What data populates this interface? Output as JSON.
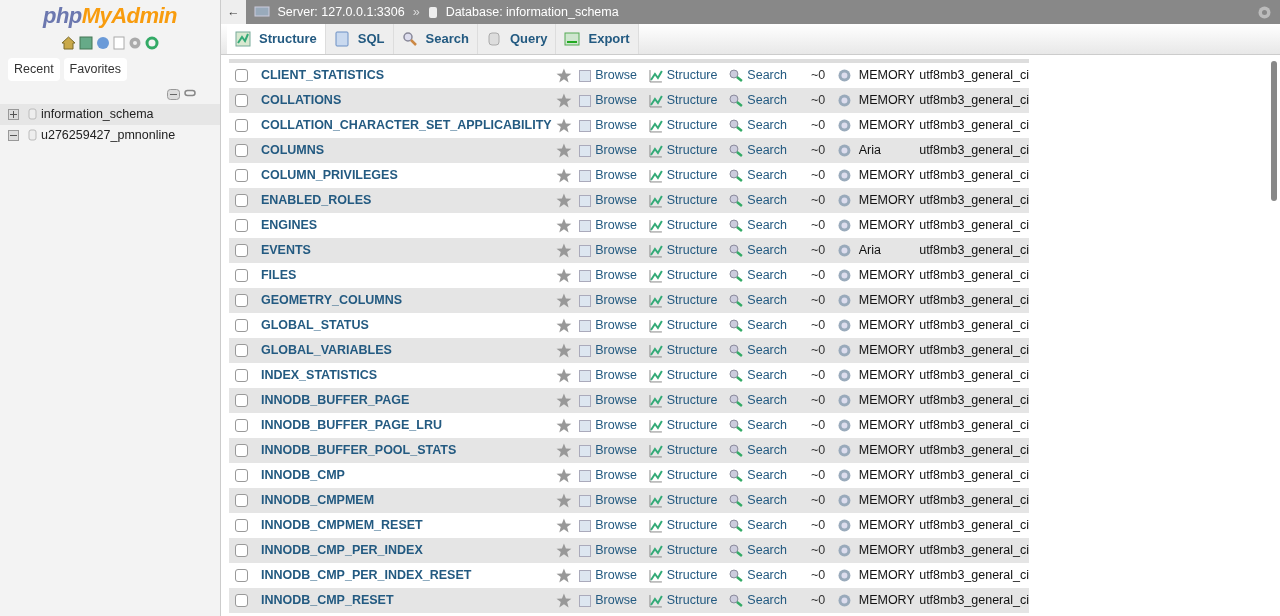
{
  "sidebar": {
    "logo_left": "php",
    "logo_right": "MyAdmin",
    "tabs": [
      {
        "label": "Recent"
      },
      {
        "label": "Favorites"
      }
    ],
    "tree": [
      {
        "label": "information_schema",
        "expanded": false
      },
      {
        "label": "u276259427_pmnonline",
        "expanded": true
      }
    ]
  },
  "breadcrumb": {
    "back": "←",
    "server": "Server: 127.0.0.1:3306",
    "separator": "»",
    "database": "Database: information_schema"
  },
  "tabs": [
    {
      "label": "Structure",
      "selected": true
    },
    {
      "label": "SQL",
      "selected": false
    },
    {
      "label": "Search",
      "selected": false
    },
    {
      "label": "Query",
      "selected": false
    },
    {
      "label": "Export",
      "selected": false
    }
  ],
  "rows": [
    {
      "name": "CLIENT_STATISTICS",
      "checked": false,
      "browse": "Browse",
      "structure": "Structure",
      "search": "Search",
      "rows": "~0",
      "engine": "MEMORY",
      "collation": "utf8mb3_general_ci"
    },
    {
      "name": "COLLATIONS",
      "checked": false,
      "browse": "Browse",
      "structure": "Structure",
      "search": "Search",
      "rows": "~0",
      "engine": "MEMORY",
      "collation": "utf8mb3_general_ci"
    },
    {
      "name": "COLLATION_CHARACTER_SET_APPLICABILITY",
      "checked": false,
      "browse": "Browse",
      "structure": "Structure",
      "search": "Search",
      "rows": "~0",
      "engine": "MEMORY",
      "collation": "utf8mb3_general_ci"
    },
    {
      "name": "COLUMNS",
      "checked": false,
      "browse": "Browse",
      "structure": "Structure",
      "search": "Search",
      "rows": "~0",
      "engine": "Aria",
      "collation": "utf8mb3_general_ci"
    },
    {
      "name": "COLUMN_PRIVILEGES",
      "checked": false,
      "browse": "Browse",
      "structure": "Structure",
      "search": "Search",
      "rows": "~0",
      "engine": "MEMORY",
      "collation": "utf8mb3_general_ci"
    },
    {
      "name": "ENABLED_ROLES",
      "checked": false,
      "browse": "Browse",
      "structure": "Structure",
      "search": "Search",
      "rows": "~0",
      "engine": "MEMORY",
      "collation": "utf8mb3_general_ci"
    },
    {
      "name": "ENGINES",
      "checked": false,
      "browse": "Browse",
      "structure": "Structure",
      "search": "Search",
      "rows": "~0",
      "engine": "MEMORY",
      "collation": "utf8mb3_general_ci"
    },
    {
      "name": "EVENTS",
      "checked": false,
      "browse": "Browse",
      "structure": "Structure",
      "search": "Search",
      "rows": "~0",
      "engine": "Aria",
      "collation": "utf8mb3_general_ci"
    },
    {
      "name": "FILES",
      "checked": false,
      "browse": "Browse",
      "structure": "Structure",
      "search": "Search",
      "rows": "~0",
      "engine": "MEMORY",
      "collation": "utf8mb3_general_ci"
    },
    {
      "name": "GEOMETRY_COLUMNS",
      "checked": false,
      "browse": "Browse",
      "structure": "Structure",
      "search": "Search",
      "rows": "~0",
      "engine": "MEMORY",
      "collation": "utf8mb3_general_ci"
    },
    {
      "name": "GLOBAL_STATUS",
      "checked": false,
      "browse": "Browse",
      "structure": "Structure",
      "search": "Search",
      "rows": "~0",
      "engine": "MEMORY",
      "collation": "utf8mb3_general_ci"
    },
    {
      "name": "GLOBAL_VARIABLES",
      "checked": false,
      "browse": "Browse",
      "structure": "Structure",
      "search": "Search",
      "rows": "~0",
      "engine": "MEMORY",
      "collation": "utf8mb3_general_ci"
    },
    {
      "name": "INDEX_STATISTICS",
      "checked": false,
      "browse": "Browse",
      "structure": "Structure",
      "search": "Search",
      "rows": "~0",
      "engine": "MEMORY",
      "collation": "utf8mb3_general_ci"
    },
    {
      "name": "INNODB_BUFFER_PAGE",
      "checked": false,
      "browse": "Browse",
      "structure": "Structure",
      "search": "Search",
      "rows": "~0",
      "engine": "MEMORY",
      "collation": "utf8mb3_general_ci"
    },
    {
      "name": "INNODB_BUFFER_PAGE_LRU",
      "checked": false,
      "browse": "Browse",
      "structure": "Structure",
      "search": "Search",
      "rows": "~0",
      "engine": "MEMORY",
      "collation": "utf8mb3_general_ci"
    },
    {
      "name": "INNODB_BUFFER_POOL_STATS",
      "checked": false,
      "browse": "Browse",
      "structure": "Structure",
      "search": "Search",
      "rows": "~0",
      "engine": "MEMORY",
      "collation": "utf8mb3_general_ci"
    },
    {
      "name": "INNODB_CMP",
      "checked": false,
      "browse": "Browse",
      "structure": "Structure",
      "search": "Search",
      "rows": "~0",
      "engine": "MEMORY",
      "collation": "utf8mb3_general_ci"
    },
    {
      "name": "INNODB_CMPMEM",
      "checked": false,
      "browse": "Browse",
      "structure": "Structure",
      "search": "Search",
      "rows": "~0",
      "engine": "MEMORY",
      "collation": "utf8mb3_general_ci"
    },
    {
      "name": "INNODB_CMPMEM_RESET",
      "checked": false,
      "browse": "Browse",
      "structure": "Structure",
      "search": "Search",
      "rows": "~0",
      "engine": "MEMORY",
      "collation": "utf8mb3_general_ci"
    },
    {
      "name": "INNODB_CMP_PER_INDEX",
      "checked": false,
      "browse": "Browse",
      "structure": "Structure",
      "search": "Search",
      "rows": "~0",
      "engine": "MEMORY",
      "collation": "utf8mb3_general_ci"
    },
    {
      "name": "INNODB_CMP_PER_INDEX_RESET",
      "checked": false,
      "browse": "Browse",
      "structure": "Structure",
      "search": "Search",
      "rows": "~0",
      "engine": "MEMORY",
      "collation": "utf8mb3_general_ci"
    },
    {
      "name": "INNODB_CMP_RESET",
      "checked": false,
      "browse": "Browse",
      "structure": "Structure",
      "search": "Search",
      "rows": "~0",
      "engine": "MEMORY",
      "collation": "utf8mb3_general_ci"
    }
  ]
}
